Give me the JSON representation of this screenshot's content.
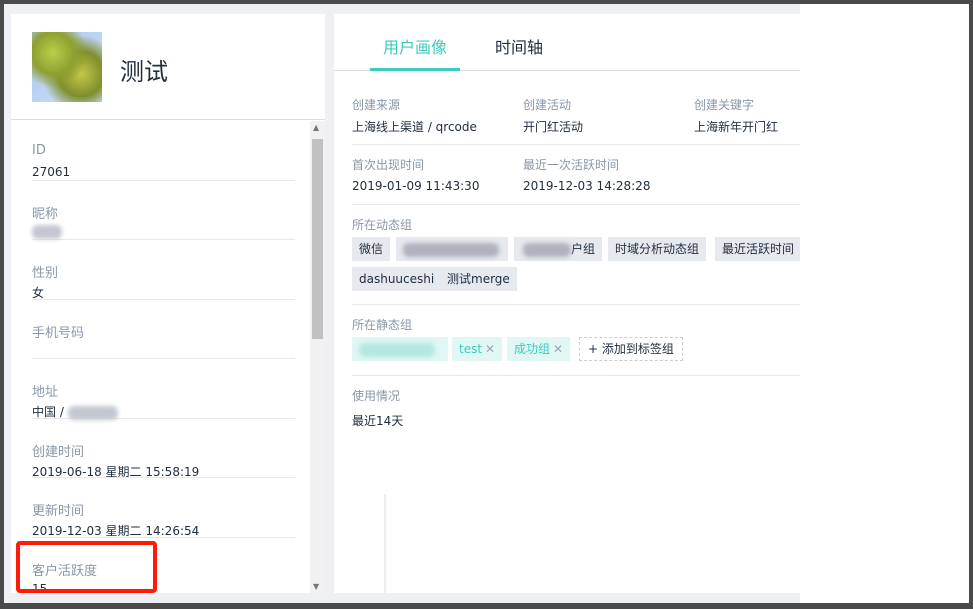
{
  "user": {
    "name": "测试"
  },
  "fields": [
    {
      "label": "ID",
      "value": "27061"
    },
    {
      "label": "昵称",
      "value": ""
    },
    {
      "label": "性别",
      "value": "女"
    },
    {
      "label": "手机号码",
      "value": ""
    },
    {
      "label": "地址",
      "value": "中国 /"
    },
    {
      "label": "创建时间",
      "value": "2019-06-18 星期二 15:58:19"
    },
    {
      "label": "更新时间",
      "value": "2019-12-03 星期二 14:26:54"
    },
    {
      "label": "客户活跃度",
      "value": "15"
    }
  ],
  "tabs": [
    {
      "label": "用户画像",
      "active": true
    },
    {
      "label": "时间轴",
      "active": false
    }
  ],
  "profile": {
    "source_label": "创建来源",
    "source_value": "上海线上渠道 / qrcode",
    "activity_label": "创建活动",
    "activity_value": "开门红活动",
    "keyword_label": "创建关键字",
    "keyword_value": "上海新年开门红",
    "first_seen_label": "首次出现时间",
    "first_seen_value": "2019-01-09 11:43:30",
    "last_active_label": "最近一次活跃时间",
    "last_active_value": "2019-12-03 14:28:28",
    "dynamic_groups_label": "所在动态组",
    "dynamic_groups": [
      "微信",
      "",
      "户组",
      "时域分析动态组",
      "最近活跃时间",
      "dashuuceshi",
      "测试merge"
    ],
    "static_groups_label": "所在静态组",
    "static_groups": [
      "",
      "test",
      "成功组"
    ],
    "add_tag_label": "+ 添加到标签组",
    "usage_label": "使用情况",
    "usage_value": "最近14天"
  },
  "colors": {
    "accent": "#3ccbbf",
    "highlight": "#ff1a0a"
  }
}
